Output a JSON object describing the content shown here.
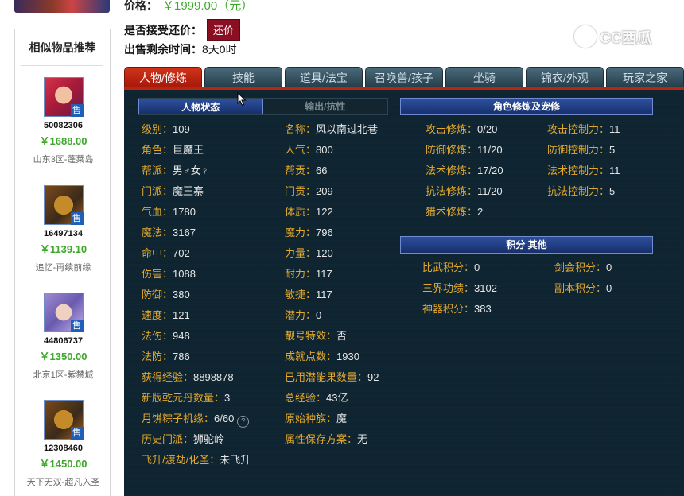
{
  "header": {
    "price_label": "价格：",
    "price_value": "￥1999.00（元）",
    "bargain_label": "是否接受还价：",
    "bargain_button": "还价",
    "remain_label": "出售剩余时间：",
    "remain_value": "8天0时"
  },
  "watermark": {
    "text": "CC西瓜"
  },
  "sidebar": {
    "title": "相似物品推荐",
    "sell_badge": "售",
    "items": [
      {
        "id": "50082306",
        "price": "￥1688.00",
        "server": "山东3区-蓬莱岛",
        "icon": "female-character-avatar"
      },
      {
        "id": "16497134",
        "price": "￥1139.10",
        "server": "追忆-再续前缘",
        "icon": "demon-king-avatar"
      },
      {
        "id": "44806737",
        "price": "￥1350.00",
        "server": "北京1区-紫禁城",
        "icon": "purple-hair-character-avatar"
      },
      {
        "id": "12308460",
        "price": "￥1450.00",
        "server": "天下无双-超凡入圣",
        "icon": "demon-king-avatar"
      }
    ]
  },
  "tabs": [
    "人物/修炼",
    "技能",
    "道具/法宝",
    "召唤兽/孩子",
    "坐骑",
    "锦衣/外观",
    "玩家之家"
  ],
  "subtabs": [
    "人物状态",
    "输出/抗性"
  ],
  "left_col": [
    {
      "label": "级别：",
      "value": "109"
    },
    {
      "label": "角色：",
      "value": "巨魔王"
    },
    {
      "label": "帮派：",
      "value": "男♂女♀"
    },
    {
      "label": "门派：",
      "value": "魔王寨"
    },
    {
      "label": "气血：",
      "value": "1780"
    },
    {
      "label": "魔法：",
      "value": "3167"
    },
    {
      "label": "命中：",
      "value": "702"
    },
    {
      "label": "伤害：",
      "value": "1088"
    },
    {
      "label": "防御：",
      "value": "380"
    },
    {
      "label": "速度：",
      "value": "121"
    },
    {
      "label": "法伤：",
      "value": "948"
    },
    {
      "label": "法防：",
      "value": "786"
    },
    {
      "label": "获得经验：",
      "value": "8898878"
    },
    {
      "label": "新版乾元丹数量：",
      "value": "3"
    },
    {
      "label": "月饼粽子机缘：",
      "value": "6/60"
    },
    {
      "label": "历史门派：",
      "value": "狮驼岭"
    },
    {
      "label": "飞升/渡劫/化圣：",
      "value": "未飞升"
    }
  ],
  "right_col": [
    {
      "label": "名称：",
      "value": "风以南过北巷"
    },
    {
      "label": "人气：",
      "value": "800"
    },
    {
      "label": "帮贡：",
      "value": "66"
    },
    {
      "label": "门贡：",
      "value": "209"
    },
    {
      "label": "体质：",
      "value": "122"
    },
    {
      "label": "魔力：",
      "value": "796"
    },
    {
      "label": "力量：",
      "value": "120"
    },
    {
      "label": "耐力：",
      "value": "117"
    },
    {
      "label": "敏捷：",
      "value": "117"
    },
    {
      "label": "潜力：",
      "value": "0"
    },
    {
      "label": "靓号特效：",
      "value": "否"
    },
    {
      "label": "成就点数：",
      "value": "1930"
    },
    {
      "label": "已用潜能果数量：",
      "value": "92"
    },
    {
      "label": "总经验：",
      "value": "43亿"
    },
    {
      "label": "原始种族：",
      "value": "魔"
    },
    {
      "label": "属性保存方案：",
      "value": "无"
    }
  ],
  "cultivation": {
    "title": "角色修炼及宠修",
    "left": [
      {
        "label": "攻击修炼：",
        "value": "0/20"
      },
      {
        "label": "防御修炼：",
        "value": "11/20"
      },
      {
        "label": "法术修炼：",
        "value": "17/20"
      },
      {
        "label": "抗法修炼：",
        "value": "11/20"
      },
      {
        "label": "猎术修炼：",
        "value": "2"
      }
    ],
    "right": [
      {
        "label": "攻击控制力：",
        "value": "11"
      },
      {
        "label": "防御控制力：",
        "value": "5"
      },
      {
        "label": "法术控制力：",
        "value": "11"
      },
      {
        "label": "抗法控制力：",
        "value": "5"
      }
    ]
  },
  "points": {
    "title": "积分 其他",
    "left": [
      {
        "label": "比武积分：",
        "value": "0"
      },
      {
        "label": "三界功绩：",
        "value": "3102"
      },
      {
        "label": "神器积分：",
        "value": "383"
      }
    ],
    "right": [
      {
        "label": "剑会积分：",
        "value": "0"
      },
      {
        "label": "副本积分：",
        "value": "0"
      }
    ]
  },
  "colors": {
    "label": "#e3a92e",
    "value": "#e6e6e6",
    "price": "#3fa82c",
    "active_tab": "#c02a12",
    "panel_bg": "#0e2430"
  }
}
